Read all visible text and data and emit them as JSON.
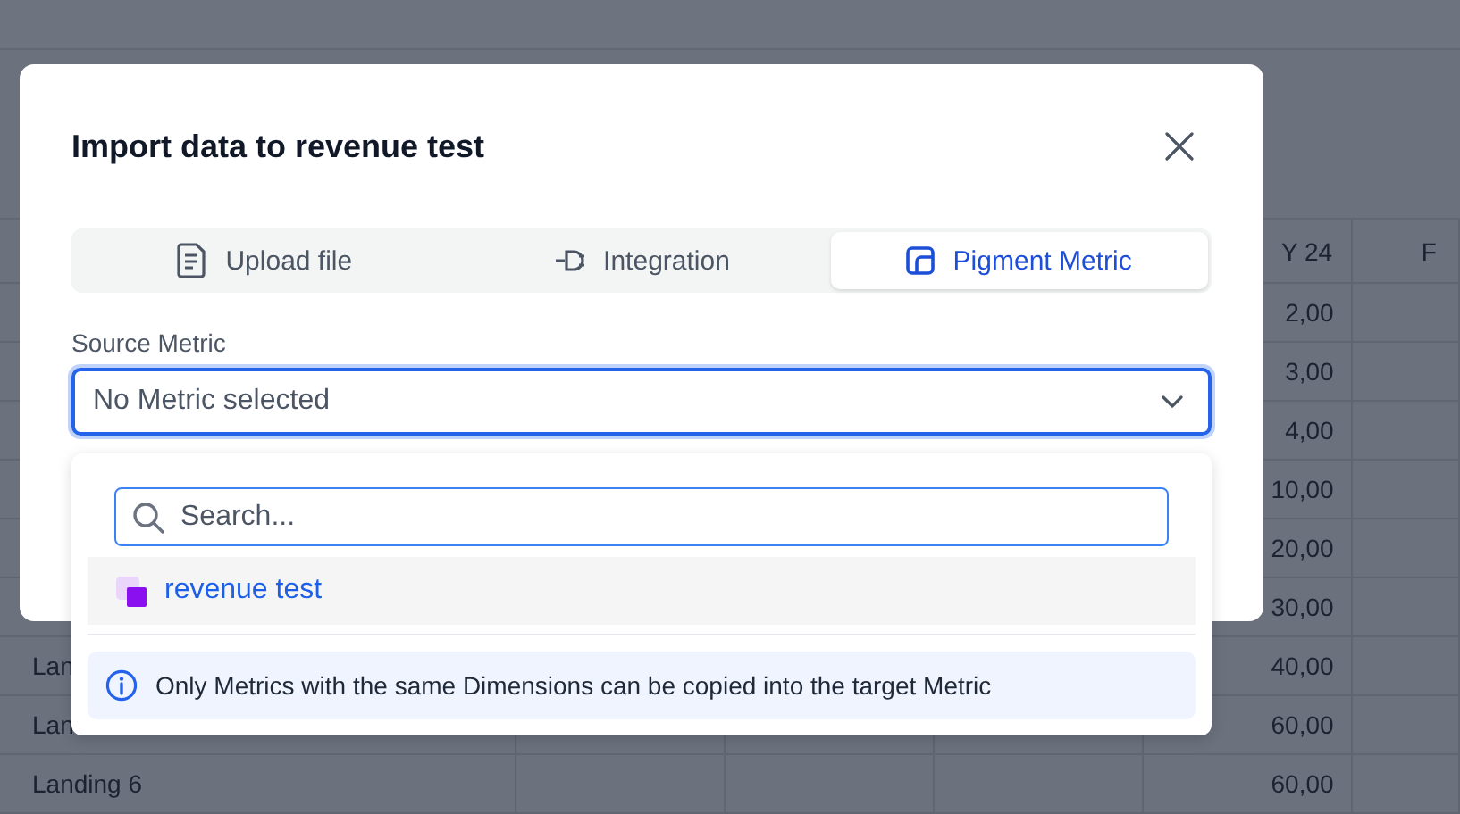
{
  "table": {
    "column_5_header": "Y 24",
    "column_6_header": "F",
    "rows": [
      {
        "value": "2,00"
      },
      {
        "value": "3,00"
      },
      {
        "value": "4,00"
      },
      {
        "value": "10,00"
      },
      {
        "value": "20,00"
      },
      {
        "value": "30,00"
      },
      {
        "label": "Lan",
        "value": "40,00"
      },
      {
        "label": "Lan",
        "value": "60,00"
      },
      {
        "label": "Landing 6",
        "value": "60,00"
      }
    ]
  },
  "dialog": {
    "title": "Import data to revenue test",
    "tabs": [
      {
        "label": "Upload file",
        "kind": "document",
        "selected": false
      },
      {
        "label": "Integration",
        "kind": "plug",
        "selected": false
      },
      {
        "label": "Pigment Metric",
        "kind": "metric",
        "selected": true
      }
    ],
    "field_label": "Source Metric",
    "select": {
      "placeholder": "No Metric selected",
      "expanded": true
    },
    "dropdown": {
      "search": {
        "placeholder": "Search..."
      },
      "options": [
        {
          "label": "revenue test",
          "highlighted": true
        }
      ],
      "info": "Only Metrics with the same Dimensions can be copied into the target Metric"
    }
  }
}
